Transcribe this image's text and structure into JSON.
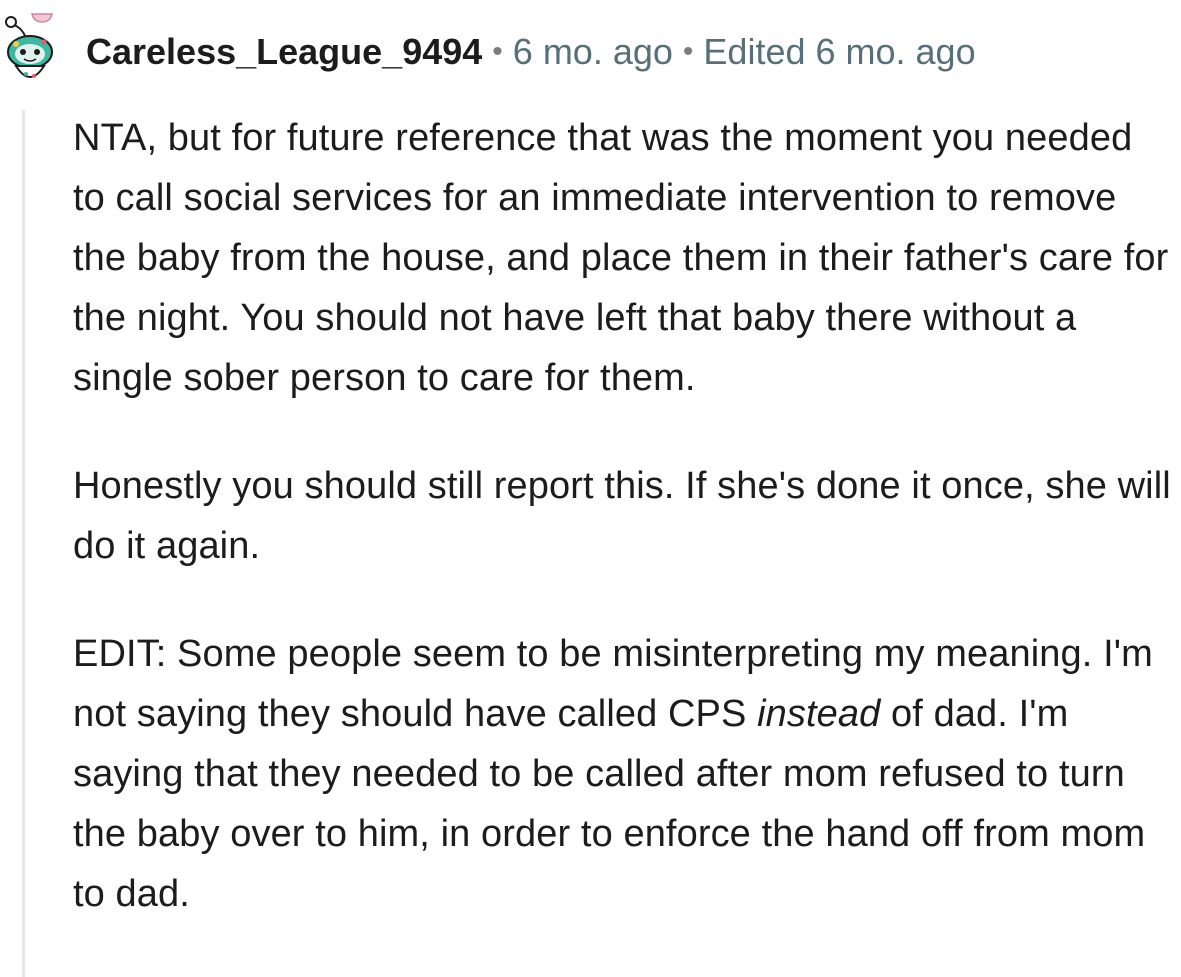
{
  "comment": {
    "author": "Careless_League_9494",
    "separator": "•",
    "timestamp": "6 mo. ago",
    "edited": "Edited 6 mo. ago",
    "avatar_icon": "snoo-avatar-icon",
    "colors": {
      "text": "#1c1c1c",
      "meta": "#576f76",
      "thread_line": "#e5e7e8",
      "avatar_green": "#3fb8a2"
    },
    "paragraphs": {
      "p1": "NTA, but for future reference that was the moment you needed to call social services for an immediate intervention to remove the baby from the house, and place them in their father's care for the night. You should not have left that baby there without a single sober person to care for them.",
      "p2": "Honestly you should still report this. If she's done it once, she will do it again.",
      "p3_part1": "EDIT: Some people seem to be misinterpreting my meaning. I'm not saying they should have called CPS ",
      "p3_em": "instead",
      "p3_part2": " of dad. I'm saying that they needed to be called after mom refused to turn the baby over to him, in order to enforce the hand off from mom to dad."
    }
  }
}
